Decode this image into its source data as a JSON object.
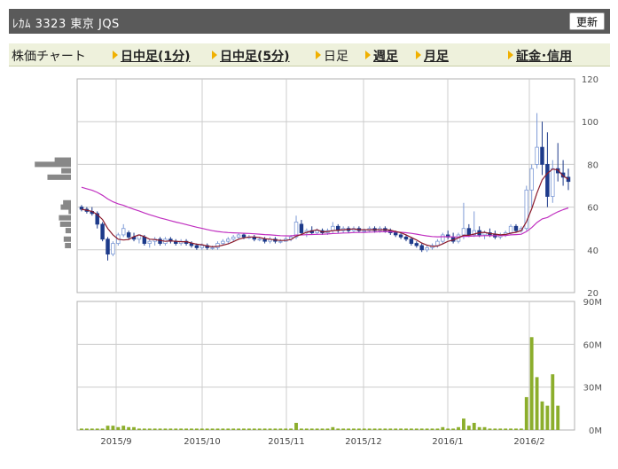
{
  "header": {
    "title": "ﾚｶﾑ 3323 東京 JQS",
    "refresh_label": "更新"
  },
  "nav": {
    "label": "株価チャート",
    "items": [
      {
        "label": "日中足(1分)",
        "link": true
      },
      {
        "label": "日中足(5分)",
        "link": true
      },
      {
        "label": "日足",
        "link": false
      },
      {
        "label": "週足",
        "link": true
      },
      {
        "label": "月足",
        "link": true
      },
      {
        "label": "証金･信用",
        "link": true
      }
    ]
  },
  "chart_data": {
    "type": "candlestick",
    "x_ticks": [
      "2015/9",
      "2015/10",
      "2015/11",
      "2015/12",
      "2016/1",
      "2016/2"
    ],
    "price_axis": {
      "ticks": [
        20,
        40,
        60,
        80,
        100,
        120
      ],
      "ylim": [
        20,
        120
      ]
    },
    "volume_axis": {
      "ticks": [
        "0M",
        "30M",
        "60M",
        "90M"
      ],
      "ylim": [
        0,
        90
      ]
    },
    "colors": {
      "up_candle": "#7d9ad6",
      "down_candle": "#1d3a8a",
      "short_ma": "#8b1a2b",
      "long_ma": "#c030c0",
      "volume": "#8cae2c",
      "volume_profile": "#888888",
      "grid": "#cccccc"
    },
    "candles": [
      {
        "o": 60,
        "h": 61,
        "l": 58,
        "c": 59
      },
      {
        "o": 59,
        "h": 60,
        "l": 57,
        "c": 58
      },
      {
        "o": 58,
        "h": 60,
        "l": 56,
        "c": 57
      },
      {
        "o": 57,
        "h": 58,
        "l": 50,
        "c": 52
      },
      {
        "o": 52,
        "h": 53,
        "l": 44,
        "c": 45
      },
      {
        "o": 45,
        "h": 46,
        "l": 35,
        "c": 38
      },
      {
        "o": 38,
        "h": 44,
        "l": 37,
        "c": 43
      },
      {
        "o": 43,
        "h": 48,
        "l": 42,
        "c": 47
      },
      {
        "o": 47,
        "h": 52,
        "l": 46,
        "c": 50
      },
      {
        "o": 48,
        "h": 49,
        "l": 45,
        "c": 46
      },
      {
        "o": 46,
        "h": 48,
        "l": 44,
        "c": 45
      },
      {
        "o": 45,
        "h": 47,
        "l": 43,
        "c": 47
      },
      {
        "o": 46,
        "h": 47,
        "l": 42,
        "c": 43
      },
      {
        "o": 43,
        "h": 45,
        "l": 41,
        "c": 44
      },
      {
        "o": 44,
        "h": 46,
        "l": 42,
        "c": 45
      },
      {
        "o": 45,
        "h": 46,
        "l": 42,
        "c": 43
      },
      {
        "o": 43,
        "h": 46,
        "l": 42,
        "c": 45
      },
      {
        "o": 45,
        "h": 46,
        "l": 43,
        "c": 44
      },
      {
        "o": 44,
        "h": 45,
        "l": 42,
        "c": 43
      },
      {
        "o": 43,
        "h": 45,
        "l": 42,
        "c": 44
      },
      {
        "o": 44,
        "h": 45,
        "l": 42,
        "c": 43
      },
      {
        "o": 43,
        "h": 44,
        "l": 41,
        "c": 42
      },
      {
        "o": 42,
        "h": 43,
        "l": 40,
        "c": 41
      },
      {
        "o": 41,
        "h": 43,
        "l": 40,
        "c": 42
      },
      {
        "o": 42,
        "h": 43,
        "l": 40,
        "c": 41
      },
      {
        "o": 41,
        "h": 42,
        "l": 40,
        "c": 41
      },
      {
        "o": 41,
        "h": 44,
        "l": 40,
        "c": 43
      },
      {
        "o": 43,
        "h": 45,
        "l": 42,
        "c": 44
      },
      {
        "o": 44,
        "h": 46,
        "l": 43,
        "c": 45
      },
      {
        "o": 45,
        "h": 47,
        "l": 44,
        "c": 46
      },
      {
        "o": 46,
        "h": 48,
        "l": 45,
        "c": 47
      },
      {
        "o": 47,
        "h": 48,
        "l": 45,
        "c": 46
      },
      {
        "o": 46,
        "h": 47,
        "l": 45,
        "c": 46
      },
      {
        "o": 46,
        "h": 47,
        "l": 44,
        "c": 45
      },
      {
        "o": 45,
        "h": 46,
        "l": 44,
        "c": 45
      },
      {
        "o": 45,
        "h": 46,
        "l": 43,
        "c": 44
      },
      {
        "o": 44,
        "h": 46,
        "l": 43,
        "c": 45
      },
      {
        "o": 45,
        "h": 46,
        "l": 43,
        "c": 44
      },
      {
        "o": 44,
        "h": 45,
        "l": 43,
        "c": 44
      },
      {
        "o": 44,
        "h": 46,
        "l": 44,
        "c": 45
      },
      {
        "o": 45,
        "h": 47,
        "l": 44,
        "c": 46
      },
      {
        "o": 46,
        "h": 56,
        "l": 45,
        "c": 53
      },
      {
        "o": 52,
        "h": 54,
        "l": 47,
        "c": 48
      },
      {
        "o": 48,
        "h": 50,
        "l": 46,
        "c": 49
      },
      {
        "o": 49,
        "h": 51,
        "l": 47,
        "c": 48
      },
      {
        "o": 48,
        "h": 50,
        "l": 47,
        "c": 49
      },
      {
        "o": 49,
        "h": 50,
        "l": 47,
        "c": 48
      },
      {
        "o": 48,
        "h": 50,
        "l": 47,
        "c": 49
      },
      {
        "o": 49,
        "h": 53,
        "l": 48,
        "c": 51
      },
      {
        "o": 51,
        "h": 52,
        "l": 48,
        "c": 49
      },
      {
        "o": 49,
        "h": 51,
        "l": 48,
        "c": 50
      },
      {
        "o": 50,
        "h": 51,
        "l": 48,
        "c": 49
      },
      {
        "o": 49,
        "h": 51,
        "l": 48,
        "c": 50
      },
      {
        "o": 50,
        "h": 51,
        "l": 48,
        "c": 49
      },
      {
        "o": 49,
        "h": 50,
        "l": 48,
        "c": 49
      },
      {
        "o": 49,
        "h": 51,
        "l": 48,
        "c": 50
      },
      {
        "o": 50,
        "h": 51,
        "l": 48,
        "c": 49
      },
      {
        "o": 49,
        "h": 51,
        "l": 48,
        "c": 50
      },
      {
        "o": 50,
        "h": 51,
        "l": 48,
        "c": 49
      },
      {
        "o": 49,
        "h": 50,
        "l": 47,
        "c": 48
      },
      {
        "o": 48,
        "h": 49,
        "l": 46,
        "c": 47
      },
      {
        "o": 47,
        "h": 48,
        "l": 45,
        "c": 46
      },
      {
        "o": 46,
        "h": 47,
        "l": 44,
        "c": 45
      },
      {
        "o": 45,
        "h": 46,
        "l": 42,
        "c": 43
      },
      {
        "o": 43,
        "h": 44,
        "l": 41,
        "c": 42
      },
      {
        "o": 42,
        "h": 43,
        "l": 39,
        "c": 40
      },
      {
        "o": 40,
        "h": 42,
        "l": 39,
        "c": 41
      },
      {
        "o": 41,
        "h": 43,
        "l": 40,
        "c": 42
      },
      {
        "o": 42,
        "h": 45,
        "l": 41,
        "c": 44
      },
      {
        "o": 44,
        "h": 48,
        "l": 43,
        "c": 47
      },
      {
        "o": 47,
        "h": 49,
        "l": 45,
        "c": 46
      },
      {
        "o": 46,
        "h": 48,
        "l": 43,
        "c": 44
      },
      {
        "o": 44,
        "h": 48,
        "l": 43,
        "c": 47
      },
      {
        "o": 47,
        "h": 62,
        "l": 45,
        "c": 50
      },
      {
        "o": 50,
        "h": 52,
        "l": 46,
        "c": 47
      },
      {
        "o": 47,
        "h": 58,
        "l": 46,
        "c": 49
      },
      {
        "o": 49,
        "h": 51,
        "l": 46,
        "c": 47
      },
      {
        "o": 47,
        "h": 49,
        "l": 45,
        "c": 48
      },
      {
        "o": 48,
        "h": 50,
        "l": 46,
        "c": 47
      },
      {
        "o": 47,
        "h": 49,
        "l": 45,
        "c": 46
      },
      {
        "o": 46,
        "h": 48,
        "l": 45,
        "c": 47
      },
      {
        "o": 47,
        "h": 49,
        "l": 46,
        "c": 48
      },
      {
        "o": 48,
        "h": 52,
        "l": 47,
        "c": 51
      },
      {
        "o": 51,
        "h": 52,
        "l": 48,
        "c": 49
      },
      {
        "o": 49,
        "h": 51,
        "l": 48,
        "c": 50
      },
      {
        "o": 50,
        "h": 70,
        "l": 49,
        "c": 68
      },
      {
        "o": 68,
        "h": 80,
        "l": 60,
        "c": 78
      },
      {
        "o": 80,
        "h": 104,
        "l": 78,
        "c": 88
      },
      {
        "o": 88,
        "h": 100,
        "l": 75,
        "c": 80
      },
      {
        "o": 80,
        "h": 95,
        "l": 60,
        "c": 65
      },
      {
        "o": 65,
        "h": 82,
        "l": 62,
        "c": 78
      },
      {
        "o": 78,
        "h": 90,
        "l": 72,
        "c": 76
      },
      {
        "o": 76,
        "h": 82,
        "l": 70,
        "c": 74
      },
      {
        "o": 74,
        "h": 78,
        "l": 68,
        "c": 72
      }
    ],
    "volumes": [
      1,
      1,
      1,
      1,
      1,
      3,
      3,
      2,
      3,
      2,
      2,
      1,
      1,
      1,
      1,
      1,
      1,
      1,
      1,
      1,
      1,
      1,
      1,
      1,
      1,
      1,
      1,
      1,
      1,
      1,
      1,
      1,
      1,
      1,
      1,
      1,
      1,
      1,
      1,
      1,
      1,
      5,
      1,
      1,
      1,
      1,
      1,
      1,
      2,
      1,
      1,
      1,
      1,
      1,
      1,
      1,
      1,
      1,
      1,
      1,
      1,
      1,
      1,
      1,
      1,
      1,
      1,
      1,
      1,
      2,
      1,
      1,
      2,
      8,
      3,
      5,
      2,
      2,
      1,
      1,
      1,
      1,
      1,
      1,
      1,
      23,
      65,
      37,
      20,
      17,
      39,
      17
    ],
    "volume_profile": [
      {
        "price": 82,
        "size": 27
      },
      {
        "price": 80,
        "size": 60
      },
      {
        "price": 77,
        "size": 16
      },
      {
        "price": 74,
        "size": 39
      },
      {
        "price": 62,
        "size": 13
      },
      {
        "price": 60,
        "size": 17
      },
      {
        "price": 58,
        "size": 4
      },
      {
        "price": 55,
        "size": 20
      },
      {
        "price": 52,
        "size": 18
      },
      {
        "price": 49,
        "size": 9
      },
      {
        "price": 45,
        "size": 12
      },
      {
        "price": 42,
        "size": 10
      }
    ]
  }
}
